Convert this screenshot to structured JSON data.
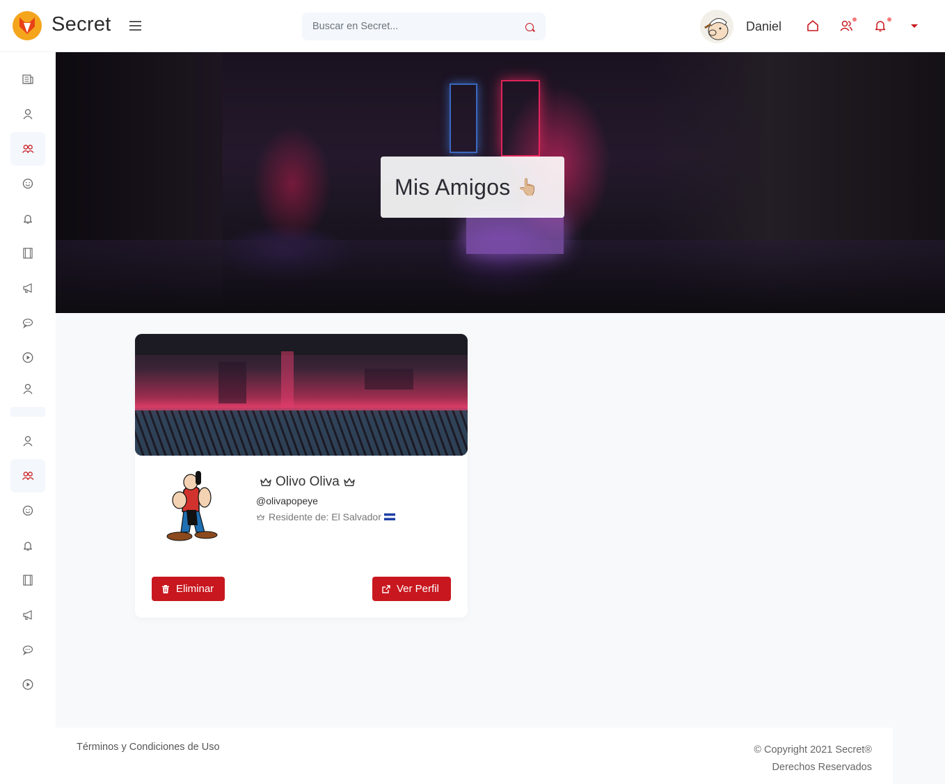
{
  "header": {
    "brand": "Secret",
    "search_placeholder": "Buscar en Secret...",
    "username": "Daniel"
  },
  "sidebar": {
    "items": [
      {
        "icon": "newspaper-icon",
        "active": false
      },
      {
        "icon": "user-icon",
        "active": false
      },
      {
        "icon": "users-icon",
        "active": true
      },
      {
        "icon": "smile-icon",
        "active": false
      },
      {
        "icon": "bell-icon",
        "active": false
      },
      {
        "icon": "film-icon",
        "active": false
      },
      {
        "icon": "megaphone-icon",
        "active": false
      },
      {
        "icon": "chat-icon",
        "active": false
      },
      {
        "icon": "play-circle-icon",
        "active": false
      },
      {
        "icon": "user-icon",
        "active": false
      },
      {
        "icon": "user-icon",
        "active": false
      },
      {
        "icon": "users-icon",
        "active": true
      },
      {
        "icon": "smile-icon",
        "active": false
      },
      {
        "icon": "bell-icon",
        "active": false
      },
      {
        "icon": "film-icon",
        "active": false
      },
      {
        "icon": "megaphone-icon",
        "active": false
      },
      {
        "icon": "chat-icon",
        "active": false
      },
      {
        "icon": "play-circle-icon",
        "active": false
      }
    ]
  },
  "hero": {
    "title": "Mis Amigos",
    "emoji": "👆🏼"
  },
  "friend": {
    "name": "Olivo Oliva",
    "handle": "@olivapopeye",
    "residence": "Residente de: El Salvador",
    "delete_label": "Eliminar",
    "view_label": "Ver Perfil"
  },
  "footer": {
    "terms": "Términos y Condiciones de Uso",
    "copyright": "© Copyright 2021 Secret®",
    "rights": "Derechos Reservados"
  },
  "colors": {
    "accent": "#c8171e",
    "page_bg": "#f8f9fb",
    "active_bg": "#f4f7fb"
  }
}
